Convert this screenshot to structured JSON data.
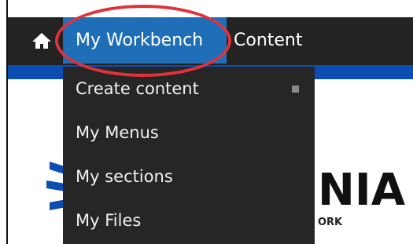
{
  "toolbar": {
    "home_icon": "home-icon",
    "active_tab_label": "My Workbench",
    "content_tab_label": "Content",
    "background_color": "#232323",
    "active_tab_color": "#1f6fb8"
  },
  "dropdown": {
    "items": [
      {
        "label": "Create content",
        "has_submenu_marker": true
      },
      {
        "label": "My Menus"
      },
      {
        "label": "My sections"
      },
      {
        "label": "My Files"
      }
    ]
  },
  "background": {
    "logo_text_partial": "NIA",
    "logo_subtext_partial": "ORK",
    "brand_blue": "#0b4db0"
  },
  "annotation": {
    "highlight_color": "#e0323c"
  }
}
